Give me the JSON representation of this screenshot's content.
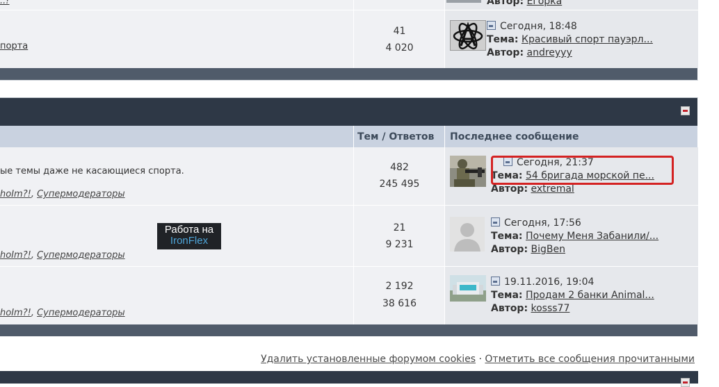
{
  "forum_top": {
    "partial_author_value": "Егорка",
    "partial_mods_text": "..!",
    "row": {
      "desc_fragment": "порта",
      "topics": "41",
      "posts": "4 020",
      "last_time": "Сегодня, 18:48",
      "last_topic_label": "Тема:",
      "last_topic": "Красивый спорт пауэрл...",
      "last_author_label": "Автор:",
      "last_author": "andreyyy",
      "author_prev_label": "Автор:"
    }
  },
  "forum_main": {
    "col_topics_replies": "Тем / Ответов",
    "col_last_post": "Последнее сообщение",
    "rows": [
      {
        "description": "ые темы даже не касающиеся спорта.",
        "mods": [
          "hoIm?!",
          "Супермодераторы"
        ],
        "topics": "482",
        "posts": "245 495",
        "last_time": "Сегодня, 21:37",
        "topic_label": "Тема:",
        "topic": "54 бригада морской пе...",
        "author_label": "Автор:",
        "author": "extremal"
      },
      {
        "description": "",
        "mods": [
          "hoIm?!",
          "Супермодераторы"
        ],
        "topics": "21",
        "posts": "9 231",
        "last_time": "Сегодня, 17:56",
        "topic_label": "Тема:",
        "topic": "Почему Меня Забанили/...",
        "author_label": "Автор:",
        "author": "BigBen"
      },
      {
        "description": "",
        "mods": [
          "hoIm?!",
          "Супермодераторы"
        ],
        "topics": "2 192",
        "posts": "38 616",
        "last_time": "19.11.2016, 19:04",
        "topic_label": "Тема:",
        "topic": "Продам 2 банки Animal...",
        "author_label": "Автор:",
        "author": "kosss77"
      }
    ],
    "badge": {
      "line1": "Работа на",
      "line2": "IronFlex"
    }
  },
  "bottom_links": {
    "delete_cookies": "Удалить установленные форумом cookies",
    "separator": "·",
    "mark_all_read": "Отметить все сообщения прочитанными"
  }
}
